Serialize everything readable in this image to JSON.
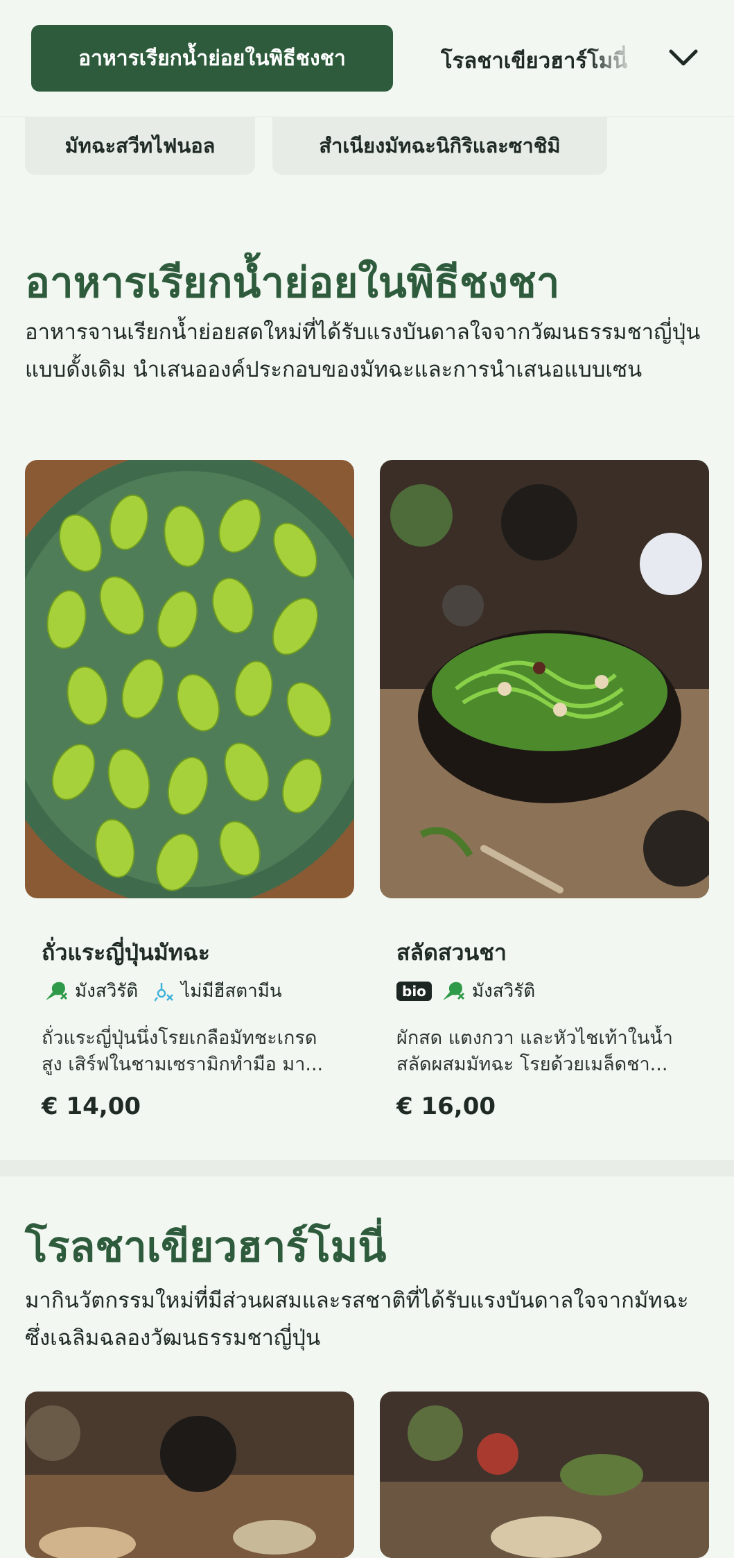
{
  "nav": {
    "active_tab": "อาหารเรียกน้ำย่อยในพิธีชงชา",
    "next_tab": "โรลชาเขียวฮาร์โมนี่",
    "sub_chips": [
      "มัทฉะสวีทไฟนอล",
      "สำเนียงมัทฉะนิกิริและซาชิมิ"
    ]
  },
  "sections": [
    {
      "title": "อาหารเรียกน้ำย่อยในพิธีชงชา",
      "description": "อาหารจานเรียกน้ำย่อยสดใหม่ที่ได้รับแรงบันดาลใจจากวัฒนธรรมชาญี่ปุ่นแบบดั้งเดิม นำเสนอองค์ประกอบของมัทฉะและการนำเสนอแบบเซน",
      "dishes": [
        {
          "name": "ถั่วแระญี่ปุ่นมัทฉะ",
          "tags": {
            "t1": "มังสวิรัติ",
            "t2": "ไม่มีฮีสตามีน"
          },
          "desc_line1": "ถั่วแระญี่ปุ่นนึ่งโรยเกลือมัทชะเกรด",
          "desc_line2": "สูง เสิร์ฟในชามเซรามิกทำมือ มา...",
          "price": "€ 14,00"
        },
        {
          "name": "สลัดสวนชา",
          "tags": {
            "bio": "bio",
            "t1": "มังสวิรัติ"
          },
          "desc_line1": "ผักสด แตงกวา และหัวไชเท้าในน้ำ",
          "desc_line2": "สลัดผสมมัทฉะ โรยด้วยเมล็ดชา...",
          "price": "€ 16,00"
        }
      ]
    },
    {
      "title": "โรลชาเขียวฮาร์โมนี่",
      "description": "มากินวัตกรรมใหม่ที่มีส่วนผสมและรสชาติที่ได้รับแรงบันดาลใจจากมัทฉะ ซึ่งเฉลิมฉลองวัฒนธรรมชาญี่ปุ่น"
    }
  ],
  "icons": {
    "vegetarian": "drumstick-crossed-icon",
    "histamine": "histamine-free-icon",
    "dropdown": "chevron-down-icon"
  },
  "colors": {
    "brand": "#2d5b3b",
    "background": "#f3f7f2",
    "chip": "#e7ece6"
  }
}
